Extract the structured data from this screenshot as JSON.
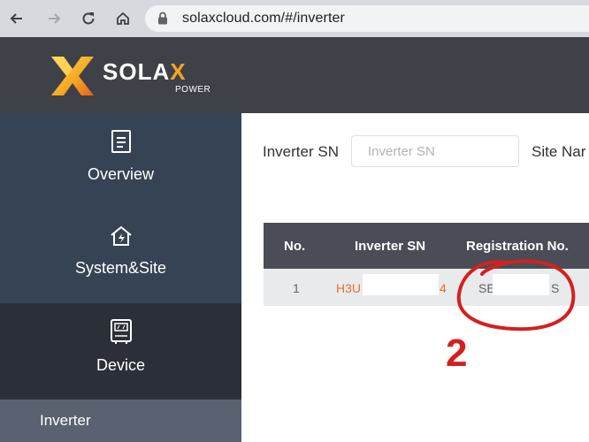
{
  "browser": {
    "url": "solaxcloud.com/#/inverter",
    "icons": [
      "back-icon",
      "forward-icon",
      "reload-icon",
      "home-icon",
      "lock-icon"
    ]
  },
  "brand": {
    "name_main": "SOLA",
    "name_accent": "X",
    "tagline": "POWER",
    "accent_color": "#f5a623"
  },
  "sidebar": {
    "items": [
      {
        "label": "Overview",
        "icon": "document-icon"
      },
      {
        "label": "System&Site",
        "icon": "house-bolt-icon"
      },
      {
        "label": "Device",
        "icon": "inverter-icon"
      }
    ],
    "submenu": {
      "label": "Inverter"
    }
  },
  "filters": {
    "sn_label": "Inverter SN",
    "sn_placeholder": "Inverter SN",
    "site_label": "Site Nar"
  },
  "table": {
    "headers": [
      "No.",
      "Inverter SN",
      "Registration No."
    ],
    "rows": [
      {
        "no": "1",
        "sn_prefix": "H3U",
        "sn_suffix": "4",
        "reg_prefix": "SE",
        "reg_suffix": "S"
      }
    ]
  },
  "annotation": {
    "label": "2",
    "color": "#d42020"
  }
}
